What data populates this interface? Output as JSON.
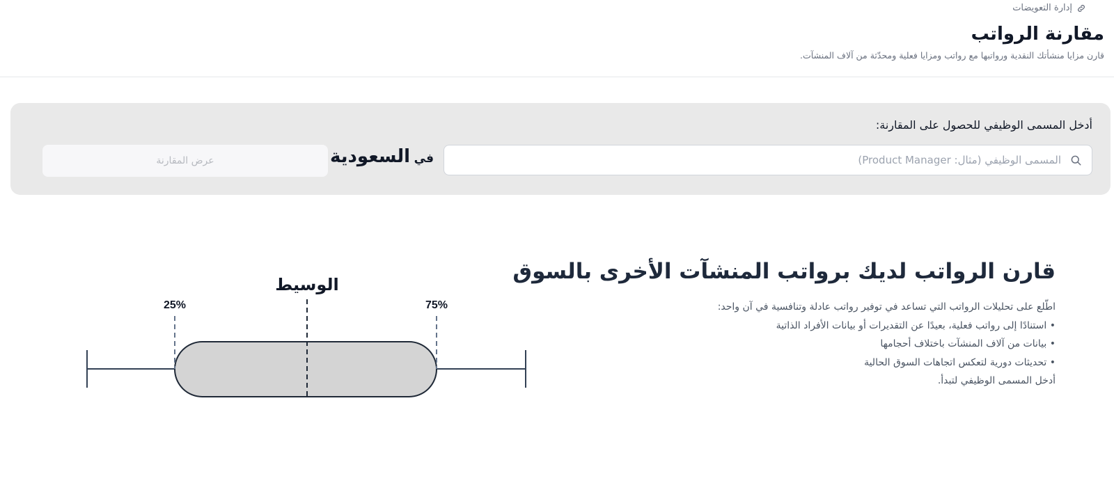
{
  "breadcrumb": {
    "label": "إدارة التعويضات",
    "icon": "link-icon"
  },
  "header": {
    "title": "مقارنة الرواتب",
    "subtitle": "قارن مزايا منشأتك النقدية ورواتبها مع رواتب ومزايا فعلية ومحدّثة من آلاف المنشآت."
  },
  "search": {
    "prompt": "أدخل المسمى الوظيفي للحصول على المقارنة:",
    "placeholder": "المسمى الوظيفي (مثال: Product Manager)",
    "value": "",
    "in_label": "في",
    "country": "السعودية",
    "button_label": "عرض المقارنة"
  },
  "info": {
    "title": "قارن الرواتب لديك برواتب المنشآت الأخرى بالسوق",
    "intro": "اطّلع على تحليلات الرواتب التي تساعد في توفير رواتب عادلة وتنافسية في آن واحد:",
    "bullets": [
      "استنادًا إلى رواتب فعلية، بعيدًا عن التقديرات أو بيانات الأفراد الذاتية",
      "بيانات من آلاف المنشآت باختلاف أحجامها",
      "تحديثات دورية لتعكس اتجاهات السوق الحالية"
    ],
    "cta": "أدخل المسمى الوظيفي لتبدأ."
  },
  "illustration": {
    "median_label": "الوسيط",
    "p25_label": "25%",
    "p75_label": "75%"
  },
  "colors": {
    "panel_bg": "#e9e9e9",
    "range_fill": "#d4d4d4",
    "line": "#334155"
  }
}
